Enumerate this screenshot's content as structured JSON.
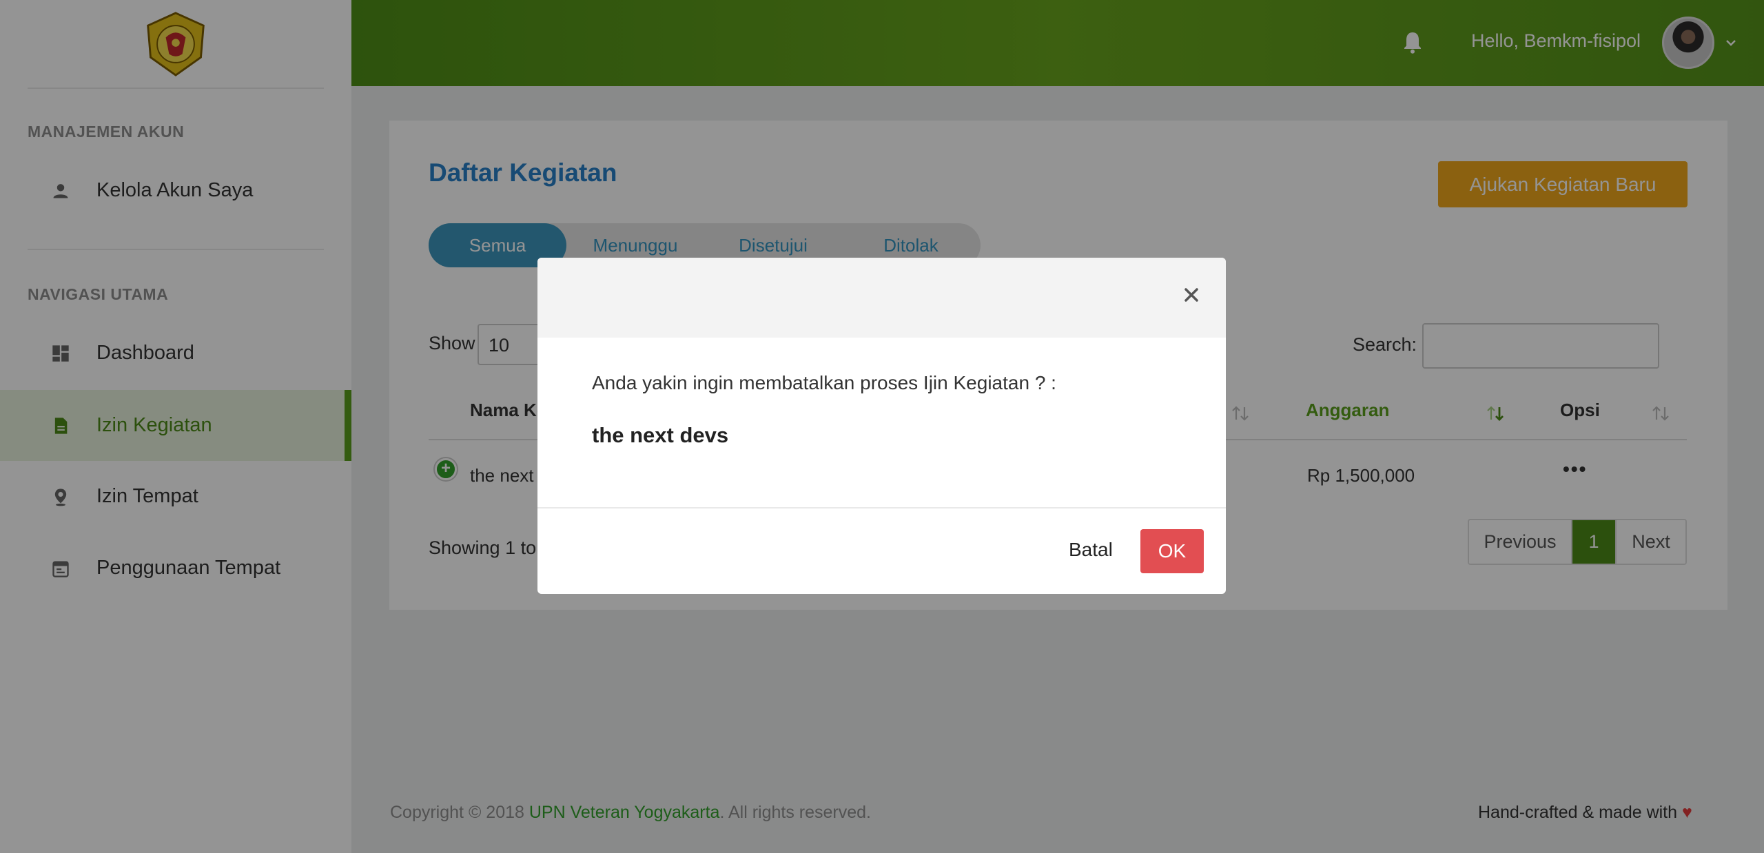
{
  "header": {
    "greeting": "Hello, Bemkm-fisipol"
  },
  "sidebar": {
    "sections": [
      {
        "heading": "MANAJEMEN AKUN"
      },
      {
        "heading": "NAVIGASI UTAMA"
      }
    ],
    "items": [
      {
        "label": "Kelola Akun Saya",
        "icon": "user-icon"
      },
      {
        "label": "Dashboard",
        "icon": "dashboard-icon"
      },
      {
        "label": "Izin Kegiatan",
        "icon": "document-icon",
        "active": true
      },
      {
        "label": "Izin Tempat",
        "icon": "location-pin-icon"
      },
      {
        "label": "Penggunaan Tempat",
        "icon": "calendar-icon"
      }
    ]
  },
  "main": {
    "title": "Daftar Kegiatan",
    "new_button": "Ajukan Kegiatan Baru",
    "tabs": [
      {
        "label": "Semua",
        "active": true
      },
      {
        "label": "Menunggu"
      },
      {
        "label": "Disetujui"
      },
      {
        "label": "Ditolak"
      }
    ],
    "show_label": "Show",
    "show_value": "10",
    "search_label": "Search:",
    "search_value": "",
    "columns": [
      "Nama Ke",
      "Anggaran",
      "Opsi"
    ],
    "rows": [
      {
        "name": "the next",
        "budget": "Rp 1,500,000",
        "options": "•••"
      }
    ],
    "info": "Showing 1 to 1",
    "pagination": {
      "previous": "Previous",
      "current": "1",
      "next": "Next"
    }
  },
  "footer": {
    "copyright_prefix": "Copyright © 2018 ",
    "brand": "UPN Veteran Yogyakarta",
    "copyright_suffix": ". All rights reserved.",
    "right_text": "Hand-crafted & made with ",
    "heart": "♥"
  },
  "modal": {
    "message": "Anda yakin ingin membatalkan proses Ijin Kegiatan ? :",
    "item_name": "the next devs",
    "cancel_label": "Batal",
    "ok_label": "OK",
    "close_glyph": "×"
  },
  "colors": {
    "brand_green": "#5a9f1d",
    "topbar_green": "#5e9a1b",
    "accent_blue": "#2980c9",
    "orange_button": "#f0a81c",
    "ok_red": "#e24e52"
  }
}
